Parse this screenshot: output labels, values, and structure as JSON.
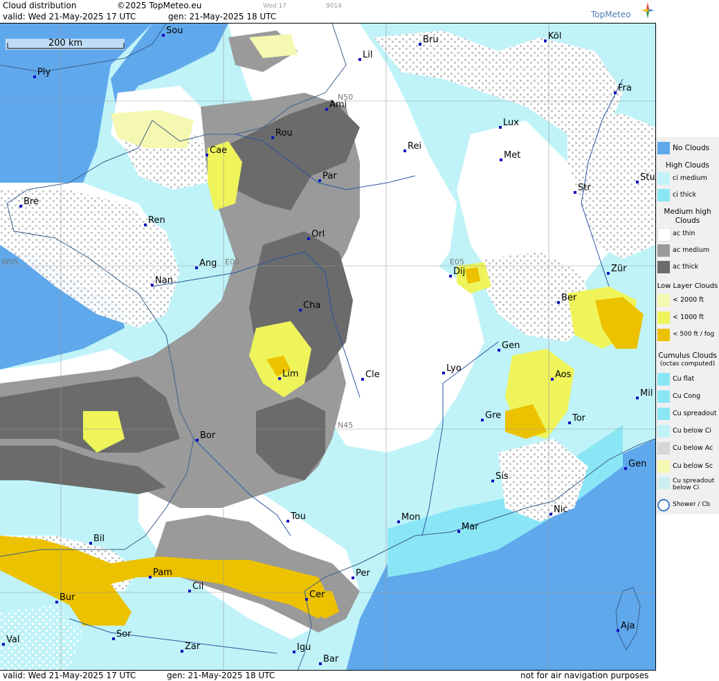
{
  "header": {
    "title": "Cloud distribution",
    "copyright": "©2025 TopMeteo.eu",
    "valid": "valid:  Wed  21-May-2025  17 UTC",
    "gen": "gen: 21-May-2025 18 UTC",
    "day_tag": "Wed 17",
    "code": "9014",
    "logo": "TopMeteo"
  },
  "footer": {
    "valid": "valid:  Wed  21-May-2025  17 UTC",
    "gen": "gen: 21-May-2025 18 UTC",
    "note": "not for air navigation purposes"
  },
  "scale_bar": "200 km",
  "grid_labels": [
    "N50",
    "N45",
    "W05",
    "E00",
    "E05"
  ],
  "cities": [
    "Sou",
    "Köl",
    "Lil",
    "Bru",
    "Ply",
    "Fra",
    "Ami",
    "Lux",
    "Rou",
    "Cae",
    "Rei",
    "Met",
    "Par",
    "Str",
    "Stu",
    "Bre",
    "Ren",
    "Orl",
    "Ang",
    "Dij",
    "Zür",
    "Nan",
    "Ber",
    "Cha",
    "Gen",
    "Lim",
    "Cle",
    "Lyo",
    "Aos",
    "Mil",
    "Gre",
    "Tor",
    "Bor",
    "Sis",
    "Gen",
    "Tou",
    "Mon",
    "Mar",
    "Nic",
    "Bil",
    "Pam",
    "Per",
    "Cil",
    "Cer",
    "Bur",
    "Aja",
    "Sor",
    "Val",
    "Zar",
    "Igu",
    "Bar"
  ],
  "legend": {
    "no_clouds": "No Clouds",
    "high_title": "High Clouds",
    "ci_medium": "ci medium",
    "ci_thick": "ci thick",
    "medium_title": "Medium high Clouds",
    "ac_thin": "ac thin",
    "ac_medium": "ac medium",
    "ac_thick": "ac thick",
    "low_title": "Low Layer Clouds",
    "low_2000": "< 2000 ft",
    "low_1000": "< 1000 ft",
    "low_500": "< 500 ft / fog",
    "cu_title": "Cumulus Clouds",
    "cu_sub": "(octas computed)",
    "cu_flat": "Cu flat",
    "cu_cong": "Cu Cong",
    "cu_spreadout": "Cu spreadout",
    "cu_below_ci": "Cu below Ci",
    "cu_below_ac": "Cu below Ac",
    "cu_below_sc": "Cu below Sc",
    "cu_spread_ci": "Cu spreadout below Ci",
    "shower": "Shower / Cb"
  },
  "colors": {
    "no_clouds": "#5fa8ec",
    "ci_medium": "#bff3f8",
    "ci_thick": "#8ae6f5",
    "ac_thin": "#ffffff",
    "ac_medium": "#9a9a9a",
    "ac_thick": "#6b6b6b",
    "low_2000": "#f5f8b0",
    "low_1000": "#eef45a",
    "low_500": "#ecc200"
  }
}
